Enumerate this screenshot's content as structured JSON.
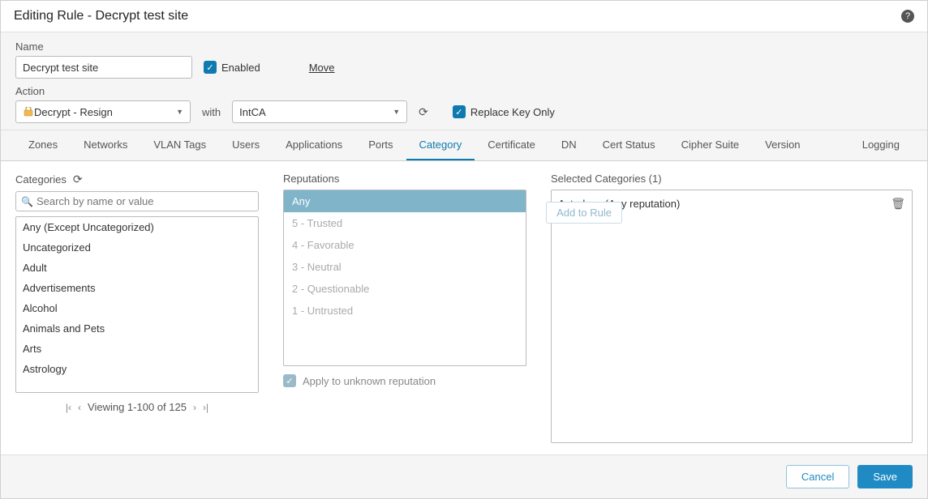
{
  "header": {
    "title": "Editing Rule - Decrypt test site"
  },
  "form": {
    "name_label": "Name",
    "name_value": "Decrypt test site",
    "enabled_label": "Enabled",
    "move_label": "Move",
    "action_label": "Action",
    "action_value": "Decrypt - Resign",
    "with_label": "with",
    "ca_value": "IntCA",
    "replace_key_label": "Replace Key Only"
  },
  "tabs": [
    "Zones",
    "Networks",
    "VLAN Tags",
    "Users",
    "Applications",
    "Ports",
    "Category",
    "Certificate",
    "DN",
    "Cert Status",
    "Cipher Suite",
    "Version"
  ],
  "tab_last": "Logging",
  "active_tab": "Category",
  "categories": {
    "title": "Categories",
    "search_placeholder": "Search by name or value",
    "items": [
      "Any (Except Uncategorized)",
      "Uncategorized",
      "Adult",
      "Advertisements",
      "Alcohol",
      "Animals and Pets",
      "Arts",
      "Astrology"
    ],
    "pager": "Viewing 1-100 of 125"
  },
  "reputations": {
    "title": "Reputations",
    "items": [
      "Any",
      "5 - Trusted",
      "4 - Favorable",
      "3 - Neutral",
      "2 - Questionable",
      "1 - Untrusted"
    ],
    "selected": "Any",
    "apply_label": "Apply to unknown reputation",
    "add_label": "Add to Rule"
  },
  "selected": {
    "title": "Selected Categories (1)",
    "items": [
      "Astrology (Any reputation)"
    ]
  },
  "footer": {
    "cancel": "Cancel",
    "save": "Save"
  }
}
